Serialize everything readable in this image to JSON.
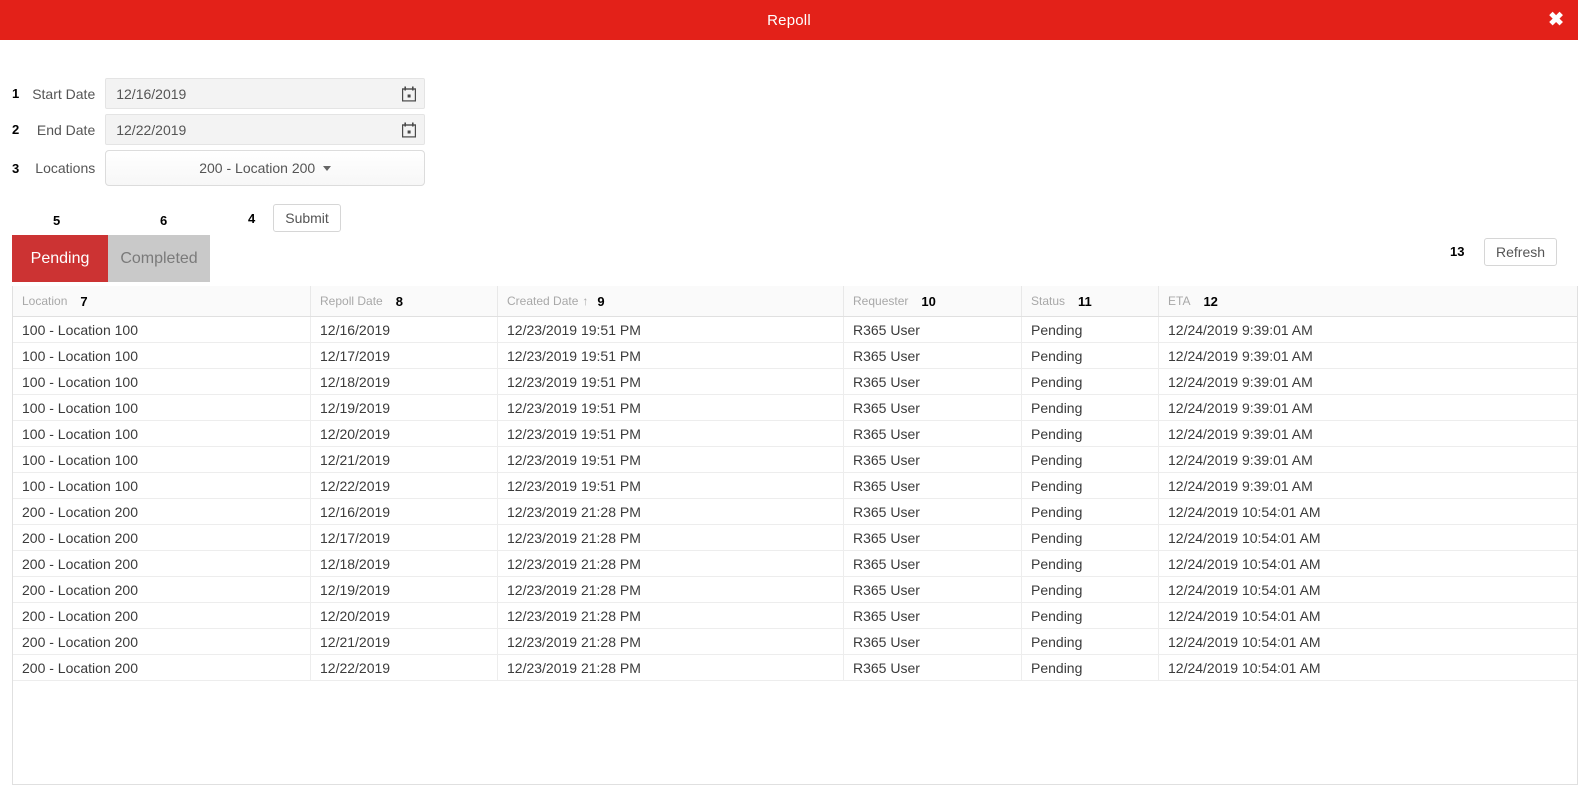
{
  "header": {
    "title": "Repoll",
    "close_label": "✖",
    "bar_color": "#e32119"
  },
  "form": {
    "start_date": {
      "annotation": "1",
      "label": "Start Date",
      "value": "12/16/2019",
      "placeholder": "mm/dd/yyyy",
      "icon": "calendar-icon"
    },
    "end_date": {
      "annotation": "2",
      "label": "End Date",
      "value": "12/22/2019",
      "placeholder": "mm/dd/yyyy",
      "icon": "calendar-icon"
    },
    "locations": {
      "annotation": "3",
      "label": "Locations",
      "value": "200 - Location 200",
      "icon": "caret-down-icon"
    },
    "submit": {
      "annotation": "4",
      "label": "Submit"
    }
  },
  "tabs": {
    "pending": {
      "annotation": "5",
      "label": "Pending",
      "active": true,
      "color": "#cc3333"
    },
    "completed": {
      "annotation": "6",
      "label": "Completed",
      "active": false,
      "color": "#c9c9c9"
    }
  },
  "refresh": {
    "annotation": "13",
    "label": "Refresh"
  },
  "grid": {
    "columns": [
      {
        "annotation": "7",
        "label": "Location",
        "sorted": ""
      },
      {
        "annotation": "8",
        "label": "Repoll Date",
        "sorted": ""
      },
      {
        "annotation": "9",
        "label": "Created Date",
        "sorted": "↑"
      },
      {
        "annotation": "10",
        "label": "Requester",
        "sorted": ""
      },
      {
        "annotation": "11",
        "label": "Status",
        "sorted": ""
      },
      {
        "annotation": "12",
        "label": "ETA",
        "sorted": ""
      }
    ],
    "rows": [
      [
        "100 - Location 100",
        "12/16/2019",
        "12/23/2019 19:51 PM",
        "R365 User",
        "Pending",
        "12/24/2019 9:39:01 AM"
      ],
      [
        "100 - Location 100",
        "12/17/2019",
        "12/23/2019 19:51 PM",
        "R365 User",
        "Pending",
        "12/24/2019 9:39:01 AM"
      ],
      [
        "100 - Location 100",
        "12/18/2019",
        "12/23/2019 19:51 PM",
        "R365 User",
        "Pending",
        "12/24/2019 9:39:01 AM"
      ],
      [
        "100 - Location 100",
        "12/19/2019",
        "12/23/2019 19:51 PM",
        "R365 User",
        "Pending",
        "12/24/2019 9:39:01 AM"
      ],
      [
        "100 - Location 100",
        "12/20/2019",
        "12/23/2019 19:51 PM",
        "R365 User",
        "Pending",
        "12/24/2019 9:39:01 AM"
      ],
      [
        "100 - Location 100",
        "12/21/2019",
        "12/23/2019 19:51 PM",
        "R365 User",
        "Pending",
        "12/24/2019 9:39:01 AM"
      ],
      [
        "100 - Location 100",
        "12/22/2019",
        "12/23/2019 19:51 PM",
        "R365 User",
        "Pending",
        "12/24/2019 9:39:01 AM"
      ],
      [
        "200 - Location 200",
        "12/16/2019",
        "12/23/2019 21:28 PM",
        "R365 User",
        "Pending",
        "12/24/2019 10:54:01 AM"
      ],
      [
        "200 - Location 200",
        "12/17/2019",
        "12/23/2019 21:28 PM",
        "R365 User",
        "Pending",
        "12/24/2019 10:54:01 AM"
      ],
      [
        "200 - Location 200",
        "12/18/2019",
        "12/23/2019 21:28 PM",
        "R365 User",
        "Pending",
        "12/24/2019 10:54:01 AM"
      ],
      [
        "200 - Location 200",
        "12/19/2019",
        "12/23/2019 21:28 PM",
        "R365 User",
        "Pending",
        "12/24/2019 10:54:01 AM"
      ],
      [
        "200 - Location 200",
        "12/20/2019",
        "12/23/2019 21:28 PM",
        "R365 User",
        "Pending",
        "12/24/2019 10:54:01 AM"
      ],
      [
        "200 - Location 200",
        "12/21/2019",
        "12/23/2019 21:28 PM",
        "R365 User",
        "Pending",
        "12/24/2019 10:54:01 AM"
      ],
      [
        "200 - Location 200",
        "12/22/2019",
        "12/23/2019 21:28 PM",
        "R365 User",
        "Pending",
        "12/24/2019 10:54:01 AM"
      ]
    ]
  }
}
